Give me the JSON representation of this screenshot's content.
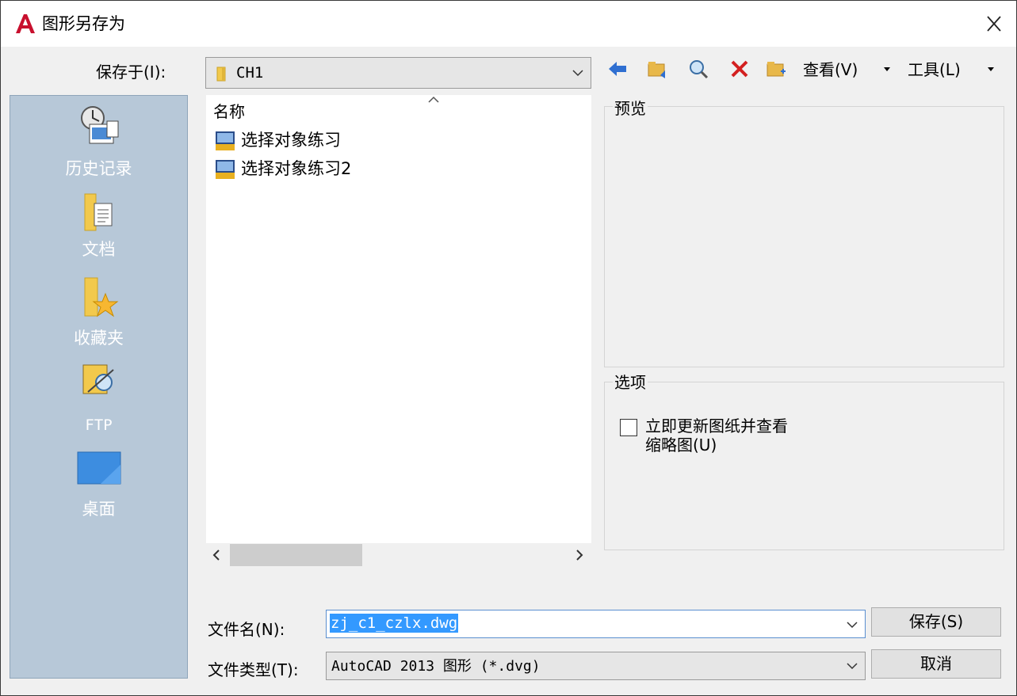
{
  "window": {
    "title": "图形另存为"
  },
  "save_in": {
    "label": "保存于(I):",
    "value": "CH1"
  },
  "toolbar": {
    "view_menu": "查看(V)",
    "tools_menu": "工具(L)"
  },
  "places": [
    {
      "label": "历史记录",
      "icon": "history-icon"
    },
    {
      "label": "文档",
      "icon": "documents-icon"
    },
    {
      "label": "收藏夹",
      "icon": "favorites-icon"
    },
    {
      "label": "FTP",
      "icon": "ftp-icon"
    },
    {
      "label": "桌面",
      "icon": "desktop-icon"
    }
  ],
  "file_list": {
    "column_header": "名称",
    "files": [
      {
        "name": "选择对象练习",
        "icon": "dwg-file-icon"
      },
      {
        "name": "选择对象练习2",
        "icon": "dwg-file-icon"
      }
    ]
  },
  "preview": {
    "title": "预览"
  },
  "options": {
    "title": "选项",
    "update_thumbnail": "立即更新图纸并查看\n缩略图(U)"
  },
  "filename": {
    "label": "文件名(N):",
    "value": "zj_c1_czlx.dwg"
  },
  "filetype": {
    "label": "文件类型(T):",
    "value": "AutoCAD 2013 图形 (*.dvg)"
  },
  "buttons": {
    "save": "保存(S)",
    "cancel": "取消"
  },
  "colors": {
    "places_bg": "#b7c8d8",
    "selection": "#3399ff",
    "logo_red": "#c8102e"
  }
}
